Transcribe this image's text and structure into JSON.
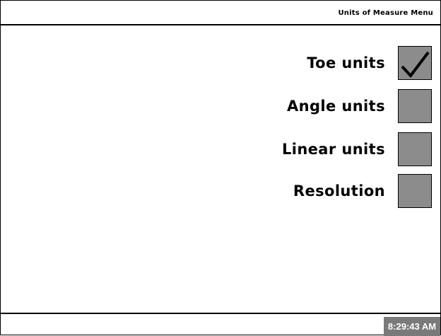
{
  "header": {
    "title": "Units of Measure Menu"
  },
  "options": [
    {
      "label": "Toe units",
      "checked": true
    },
    {
      "label": "Angle units",
      "checked": false
    },
    {
      "label": "Linear units",
      "checked": false
    },
    {
      "label": "Resolution",
      "checked": false
    }
  ],
  "footer": {
    "time": "8:29:43 AM"
  },
  "colors": {
    "checkbox_fill": "#8c8c8c",
    "clock_bg": "#7a7a7a"
  }
}
